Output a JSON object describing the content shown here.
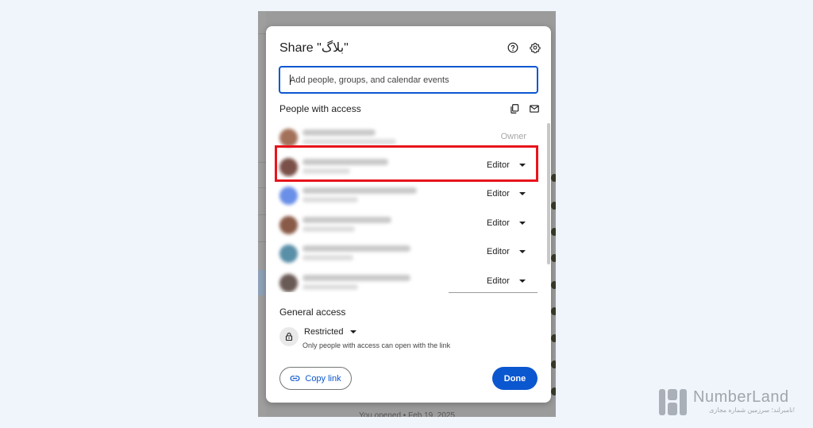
{
  "dialog": {
    "title": "Share \"بلاگ\"",
    "help_icon": "help-circle-icon",
    "settings_icon": "gear-icon",
    "add_people_placeholder": "Add people, groups, and calendar events",
    "people_section_title": "People with access",
    "copy_emails_icon": "copy-icon",
    "email_icon": "mail-icon",
    "people": [
      {
        "avatar_color": "#a3705a",
        "role": "Owner",
        "is_owner": true
      },
      {
        "avatar_color": "#7a5048",
        "role": "Editor",
        "is_owner": false
      },
      {
        "avatar_color": "#6a8fe8",
        "role": "Editor",
        "is_owner": false
      },
      {
        "avatar_color": "#8a5a48",
        "role": "Editor",
        "is_owner": false
      },
      {
        "avatar_color": "#5a8fa8",
        "role": "Editor",
        "is_owner": false
      },
      {
        "avatar_color": "#6a5a55",
        "role": "Editor",
        "is_owner": false
      }
    ],
    "general_access_title": "General access",
    "access_level": "Restricted",
    "access_description": "Only people with access can open with the link",
    "lock_icon": "lock-icon",
    "copy_link_label": "Copy link",
    "link_icon": "link-icon",
    "done_label": "Done"
  },
  "background": {
    "footer_text": "You opened • Feb 19, 2025"
  },
  "watermark": {
    "name": "NumberLand",
    "tagline": "نامبرلند؛ سرزمین شماره مجازی!"
  },
  "colors": {
    "accent": "#0b57d0",
    "highlight_box": "#e8141b"
  }
}
